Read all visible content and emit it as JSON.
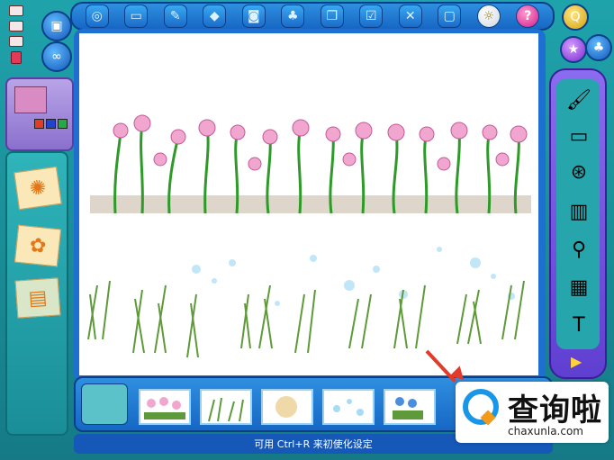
{
  "toolbar": {
    "icons": [
      "globe-icon",
      "folder-icon",
      "brush-icon",
      "diamond-icon",
      "camera-icon",
      "person-icon",
      "copy-icon",
      "checkbox-icon",
      "close-icon",
      "frame-icon",
      "lightbulb-icon",
      "help-icon"
    ],
    "help_label": "?"
  },
  "left": {
    "round1_icon": "save-icon",
    "round2_icon": "shape-icon",
    "colors": {
      "primary": "#d98cc3",
      "swatches": [
        "#e33a2a",
        "#2244cc",
        "#22aa44"
      ]
    }
  },
  "right": {
    "tools": [
      "paintbrush-icon",
      "eraser-icon",
      "spray-icon",
      "bucket-icon",
      "dropper-icon",
      "stamp-icon",
      "tee-icon"
    ],
    "next_label": "▶"
  },
  "tray": {
    "thumbs": [
      "pink-flowers",
      "grass",
      "sand",
      "bubbles",
      "blue-flowers"
    ]
  },
  "status": {
    "text": "可用 Ctrl+R 来初使化设定"
  },
  "watermark": {
    "title": "查询啦",
    "sub": "chaxunla.com"
  },
  "colors": {
    "frame": "#1fa3ab",
    "toolbar": "#1e6fd2",
    "panel": "#6f4fe0"
  }
}
